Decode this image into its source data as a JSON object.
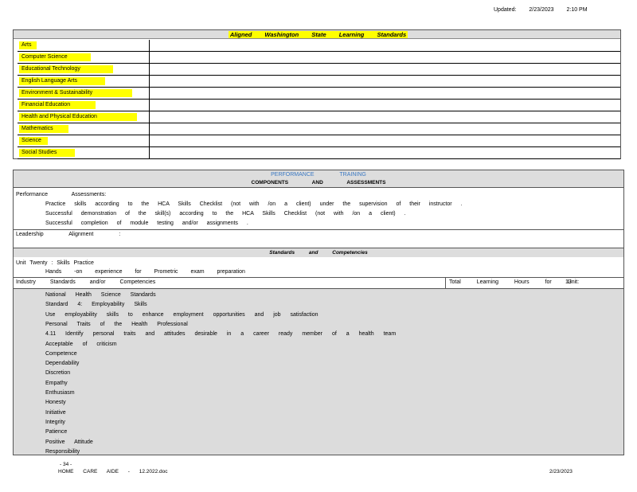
{
  "updated": {
    "label": "Updated:",
    "date": "2/23/2023",
    "time": "2:10 PM"
  },
  "standards": {
    "title": "Aligned Washington State Learning Standards",
    "subjects": [
      "Arts",
      "Computer Science",
      "Educational Technology",
      "English Language Arts",
      "Environment & Sustainability",
      "Financial Education",
      "Health and Physical Education",
      "Mathematics",
      "Science",
      "Social Studies"
    ]
  },
  "performance": {
    "header_line1": "PERFORMANCE TRAINING",
    "header_line2": "COMPONENTS AND ASSESSMENTS",
    "assess_label": "Performance Assessments:",
    "bullets": [
      "Practice skills according to the HCA Skills Checklist (not with /on a client) under the supervision of their instructor .",
      "Successful demonstration of the skill(s) according to the HCA Skills Checklist (not with /on a client) .",
      "Successful completion of module testing and/or assignments ."
    ],
    "leadership": "Leadership Alignment :",
    "band_standards": "Standards and Competencies",
    "unit_title": "Unit Twenty : Skills Practice",
    "unit_bullet": "Hands -on experience for Prometric exam preparation",
    "industry_label": "Industry Standards and/or Competencies",
    "hours_label": "Total Learning Hours for Unit:",
    "hours_value": "13",
    "competencies": [
      "National Health Science Standards",
      "Standard 4: Employability Skills",
      "Use employability skills to enhance employment opportunities and job satisfaction",
      "Personal Traits of the Health Professional",
      "4.11 Identify personal traits and attitudes desirable in a career ready member of a health team",
      "Acceptable of criticism",
      "Competence",
      "Dependability",
      "Discretion",
      "Empathy",
      "Enthusiasm",
      "Honesty",
      "Initiative",
      "Integrity",
      "Patience",
      "Positive Attitude",
      "Responsibility"
    ]
  },
  "footer": {
    "page": "- 34 -",
    "doc": "HOME CARE AIDE - 12.2022.doc",
    "date": "2/23/2023"
  },
  "bullet_glyph": "",
  "colors": {
    "highlight": "#ffff00",
    "header_blue": "#3a78c2",
    "band_gray": "#dddddd"
  }
}
